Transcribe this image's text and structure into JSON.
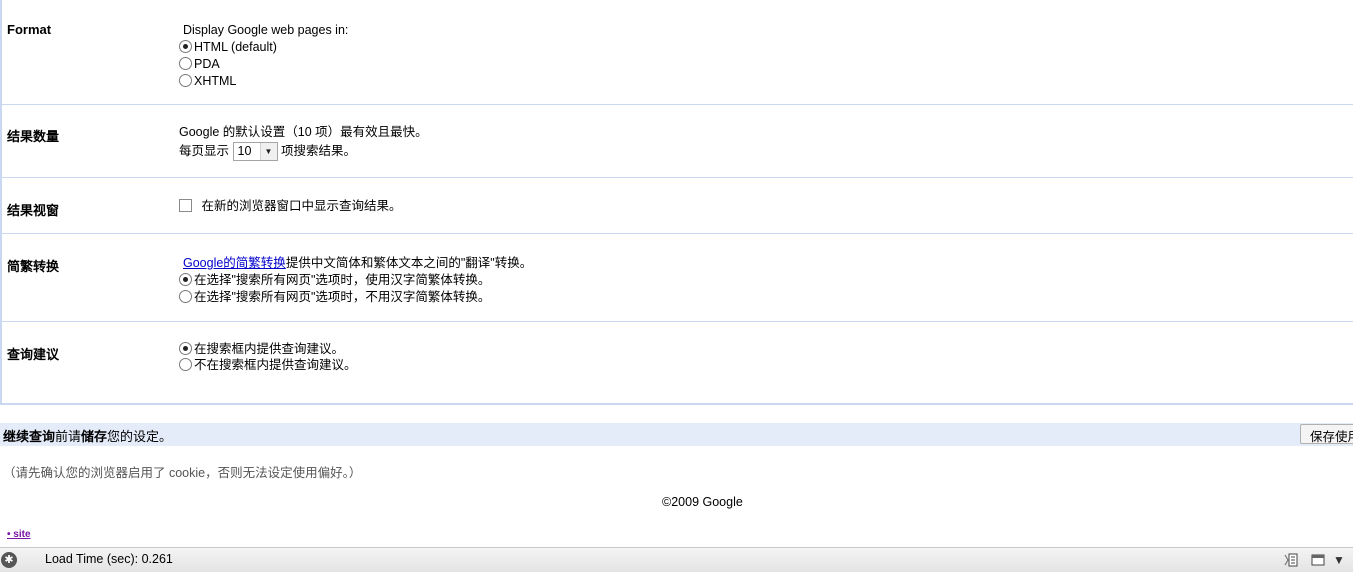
{
  "format": {
    "label": "Format",
    "prompt": "Display Google web pages in:",
    "options": [
      "HTML (default)",
      "PDA",
      "XHTML"
    ],
    "selected": 0
  },
  "results_count": {
    "label": "结果数量",
    "note": "Google 的默认设置（10 项）最有效且最快。",
    "prefix": "每页显示",
    "value": "10",
    "suffix": "项搜索结果。"
  },
  "results_window": {
    "label": "结果视窗",
    "checkbox_label": "在新的浏览器窗口中显示查询结果。",
    "checked": false
  },
  "conversion": {
    "label": "简繁转换",
    "link_text": "Google的简繁转换",
    "description": "提供中文简体和繁体文本之间的\"翻译\"转换。",
    "options": [
      "在选择\"搜索所有网页\"选项时，使用汉字简繁体转换。",
      "在选择\"搜索所有网页\"选项时，不用汉字简繁体转换。"
    ],
    "selected": 0
  },
  "suggest": {
    "label": "查询建议",
    "options": [
      "在搜索框内提供查询建议。",
      "不在搜索框内提供查询建议。"
    ],
    "selected": 0
  },
  "save_bar": {
    "bold1": "继续查询",
    "text1": "前请",
    "bold2": "储存",
    "text2": "您的设定。",
    "button": "保存使用"
  },
  "cookie_note": "（请先确认您的浏览器启用了 cookie，否则无法设定使用偏好。）",
  "copyright": "©2009 Google",
  "site_link": "• site",
  "status_bar": {
    "load_time": "Load Time (sec): 0.261"
  },
  "colors": {
    "border": "#c9d7f1",
    "save_bar_bg": "#e5ecf9",
    "link": "#0000cc",
    "site_link": "#7a14a6"
  }
}
